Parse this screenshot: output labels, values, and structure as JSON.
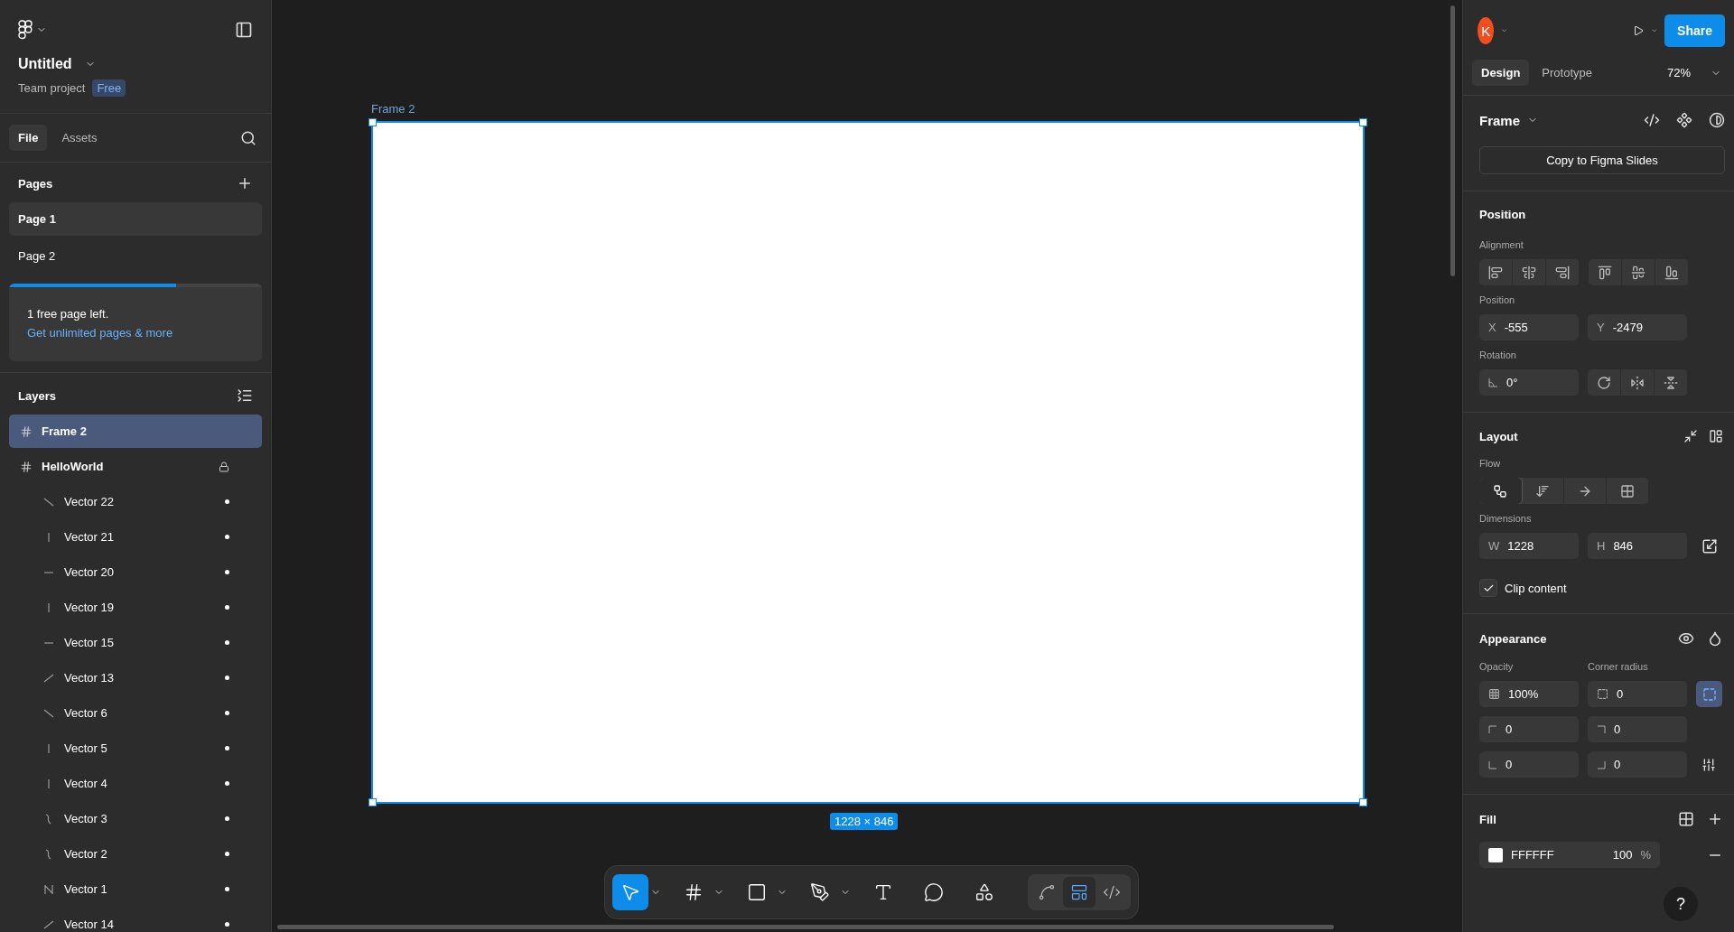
{
  "file": {
    "title": "Untitled",
    "project": "Team project",
    "plan_badge": "Free"
  },
  "left_tabs": [
    {
      "label": "File",
      "selected": true
    },
    {
      "label": "Assets",
      "selected": false
    }
  ],
  "pages": {
    "title": "Pages",
    "items": [
      {
        "label": "Page 1",
        "selected": true
      },
      {
        "label": "Page 2",
        "selected": false
      }
    ],
    "promo": {
      "level": 0.66,
      "message": "1 free page left.",
      "link": "Get unlimited pages & more"
    }
  },
  "layers": {
    "title": "Layers",
    "items": [
      {
        "name": "Frame 2",
        "kind": "frame",
        "selected": true,
        "locked": false
      },
      {
        "name": "HelloWorld",
        "kind": "frame",
        "selected": false,
        "locked": true,
        "children": [
          {
            "name": "Vector 22",
            "kind": "falling",
            "selected": false
          },
          {
            "name": "Vector 21",
            "kind": "vertical",
            "selected": false
          },
          {
            "name": "Vector 20",
            "kind": "horizontal",
            "selected": false
          },
          {
            "name": "Vector 19",
            "kind": "vertical",
            "selected": false
          },
          {
            "name": "Vector 15",
            "kind": "horizontal",
            "selected": false
          },
          {
            "name": "Vector 13",
            "kind": "rising",
            "selected": false
          },
          {
            "name": "Vector 6",
            "kind": "falling",
            "selected": false
          },
          {
            "name": "Vector 5",
            "kind": "vertical",
            "selected": false
          },
          {
            "name": "Vector 4",
            "kind": "vertical",
            "selected": false
          },
          {
            "name": "Vector 3",
            "kind": "curve",
            "selected": false
          },
          {
            "name": "Vector 2",
            "kind": "curve",
            "selected": false
          },
          {
            "name": "Vector 1",
            "kind": "path",
            "selected": false
          },
          {
            "name": "Vector 14",
            "kind": "rising",
            "selected": false
          }
        ]
      }
    ]
  },
  "canvas": {
    "frame": {
      "name": "Frame 2",
      "size": "1228 × 846"
    }
  },
  "toolbar": {
    "tools": [
      {
        "kind": "move",
        "selected": true,
        "menu": true
      },
      {
        "kind": "frame",
        "selected": false,
        "menu": true
      },
      {
        "kind": "rectangle",
        "selected": false,
        "menu": true
      },
      {
        "kind": "pen",
        "selected": false,
        "menu": true
      },
      {
        "kind": "text",
        "selected": false,
        "menu": false
      },
      {
        "kind": "comment",
        "selected": false,
        "menu": false
      },
      {
        "kind": "assets",
        "selected": false,
        "menu": false
      }
    ],
    "modes": [
      {
        "kind": "draw",
        "selected": false
      },
      {
        "kind": "design",
        "selected": true
      },
      {
        "kind": "dev",
        "selected": false
      }
    ]
  },
  "header": {
    "avatar": "K",
    "share": "Share",
    "tabs": [
      {
        "label": "Design",
        "selected": true
      },
      {
        "label": "Prototype",
        "selected": false
      }
    ],
    "zoom": "72%"
  },
  "selection": {
    "type": "Frame",
    "copy_button": "Copy to Figma Slides"
  },
  "position": {
    "title": "Position",
    "alignment_label": "Alignment",
    "position_label": "Position",
    "x": {
      "label": "X",
      "value": "-555"
    },
    "y": {
      "label": "Y",
      "value": "-2479"
    },
    "rotation_label": "Rotation",
    "rotation": "0°"
  },
  "layout": {
    "title": "Layout",
    "flow_label": "Flow",
    "flow": [
      {
        "kind": "freeform",
        "selected": true
      },
      {
        "kind": "vertical",
        "selected": false
      },
      {
        "kind": "horizontal",
        "selected": false
      },
      {
        "kind": "grid",
        "selected": false
      }
    ],
    "dimensions_label": "Dimensions",
    "w": {
      "label": "W",
      "value": "1228"
    },
    "h": {
      "label": "H",
      "value": "846"
    },
    "clip": {
      "label": "Clip content",
      "checked": true
    }
  },
  "appearance": {
    "title": "Appearance",
    "opacity_label": "Opacity",
    "opacity": "100%",
    "radius_label": "Corner radius",
    "radius": "0",
    "corners": [
      "0",
      "0",
      "0",
      "0"
    ],
    "independent_corners": true
  },
  "fill": {
    "title": "Fill",
    "color": "#ffffff",
    "hex": "FFFFFF",
    "opacity": "100",
    "unit": "%"
  },
  "help": "?"
}
